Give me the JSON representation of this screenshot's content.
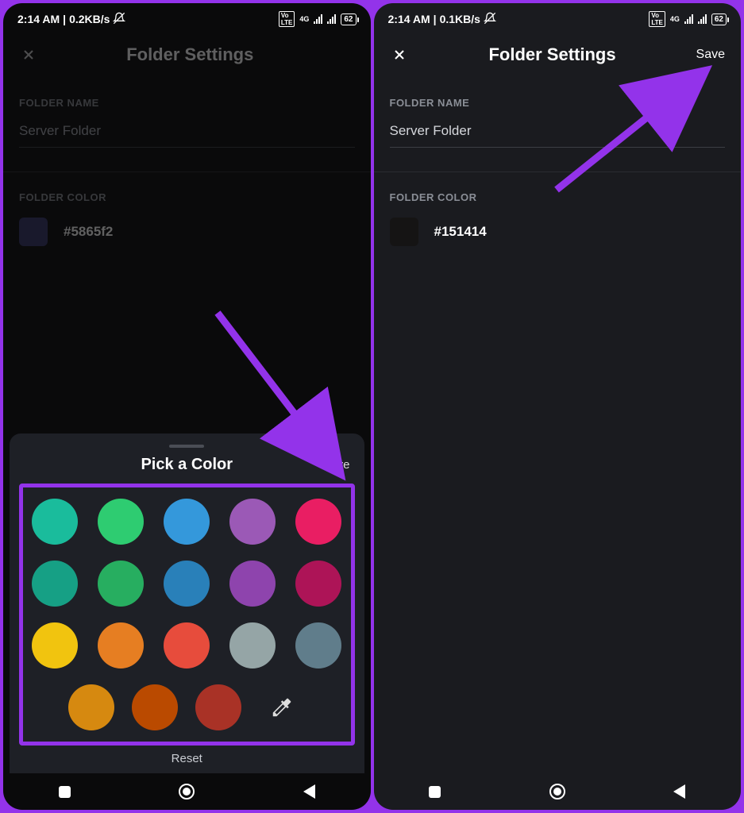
{
  "left": {
    "status": {
      "time": "2:14 AM",
      "net_speed": "0.2KB/s",
      "net_label": "4G",
      "battery": "62"
    },
    "header": {
      "title": "Folder Settings"
    },
    "folder_name": {
      "label": "FOLDER NAME",
      "value": "Server Folder"
    },
    "folder_color": {
      "label": "FOLDER COLOR",
      "hex": "#5865f2",
      "swatch": "#35366a"
    },
    "picker": {
      "title": "Pick a Color",
      "save": "Save",
      "reset": "Reset",
      "colors_row1": [
        "#1abc9c",
        "#2ecc71",
        "#3498db",
        "#9b59b6",
        "#e91e63"
      ],
      "colors_row2": [
        "#16a085",
        "#27ae60",
        "#2980b9",
        "#8e44ad",
        "#ad1457"
      ],
      "colors_row3": [
        "#f1c40f",
        "#e67e22",
        "#e74c3c",
        "#95a5a6",
        "#607d8b"
      ],
      "colors_row4": [
        "#d68910",
        "#ba4a00",
        "#a93226"
      ]
    }
  },
  "right": {
    "status": {
      "time": "2:14 AM",
      "net_speed": "0.1KB/s",
      "net_label": "4G",
      "battery": "62"
    },
    "header": {
      "title": "Folder Settings",
      "save": "Save"
    },
    "folder_name": {
      "label": "FOLDER NAME",
      "value": "Server Folder"
    },
    "folder_color": {
      "label": "FOLDER COLOR",
      "hex": "#151414",
      "swatch": "#151414"
    }
  }
}
